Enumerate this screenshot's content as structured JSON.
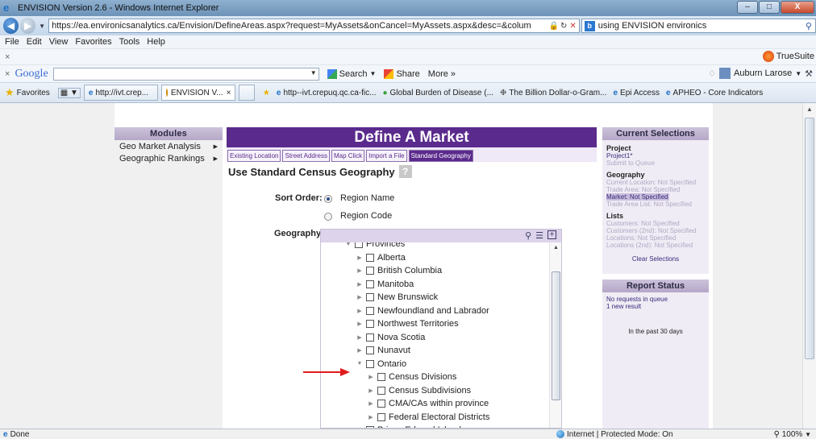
{
  "window": {
    "title": "ENVISION Version 2.6 - Windows Internet Explorer",
    "buttons": {
      "minimize": "–",
      "maximize": "□",
      "close": "X"
    }
  },
  "address_bar": {
    "url": "https://ea.environicsanalytics.ca/Envision/DefineAreas.aspx?request=MyAssets&onCancel=MyAssets.aspx&desc=&column=0&forceStd=0&pageloc=",
    "search_text": "using ENVISION environics"
  },
  "menu": [
    "File",
    "Edit",
    "View",
    "Favorites",
    "Tools",
    "Help"
  ],
  "toolbar1": {
    "close": "×",
    "truesuite": "TrueSuite"
  },
  "google_bar": {
    "close": "×",
    "logo": "Google",
    "search": "Search",
    "share": "Share",
    "more": "More »",
    "user": "Auburn Larose"
  },
  "favorites_bar": {
    "favorites": "Favorites",
    "tabs": [
      "http://ivt.crep...",
      "ENVISION V..."
    ],
    "tab_close": "×",
    "links": [
      "http--ivt.crepuq.qc.ca-fic...",
      "Global Burden of Disease (...",
      "The Billion Dollar-o-Gram...",
      "Epi Access",
      "APHEO - Core Indicators"
    ]
  },
  "modules": {
    "header": "Modules",
    "items": [
      "Geo Market Analysis",
      "Geographic Rankings"
    ]
  },
  "main": {
    "title": "Define A Market",
    "tabs": [
      "Existing Location",
      "Street Address",
      "Map Click",
      "Import a File",
      "Standard Geography"
    ],
    "active_tab": 4,
    "section_title": "Use Standard Census Geography",
    "help": "?",
    "sort_order_label": "Sort Order:",
    "sort_options": [
      "Region Name",
      "Region Code"
    ],
    "sort_selected": 0,
    "geography_label": "Geography:",
    "geo_tools": {
      "search": "search-icon",
      "list": "list-icon",
      "expand": "+"
    },
    "tree": [
      {
        "label": "Provinces",
        "level": 0,
        "state": "expanded"
      },
      {
        "label": "Alberta",
        "level": 1,
        "state": "collapsed"
      },
      {
        "label": "British Columbia",
        "level": 1,
        "state": "collapsed"
      },
      {
        "label": "Manitoba",
        "level": 1,
        "state": "collapsed"
      },
      {
        "label": "New Brunswick",
        "level": 1,
        "state": "collapsed"
      },
      {
        "label": "Newfoundland and Labrador",
        "level": 1,
        "state": "collapsed"
      },
      {
        "label": "Northwest Territories",
        "level": 1,
        "state": "collapsed"
      },
      {
        "label": "Nova Scotia",
        "level": 1,
        "state": "collapsed"
      },
      {
        "label": "Nunavut",
        "level": 1,
        "state": "collapsed"
      },
      {
        "label": "Ontario",
        "level": 1,
        "state": "expanded"
      },
      {
        "label": "Census Divisions",
        "level": 2,
        "state": "collapsed"
      },
      {
        "label": "Census Subdivisions",
        "level": 2,
        "state": "collapsed"
      },
      {
        "label": "CMA/CAs within province",
        "level": 2,
        "state": "collapsed"
      },
      {
        "label": "Federal Electoral Districts",
        "level": 2,
        "state": "collapsed"
      },
      {
        "label": "Prince Edward Island",
        "level": 1,
        "state": "collapsed"
      }
    ]
  },
  "current_selections": {
    "header": "Current Selections",
    "project_h": "Project",
    "project": "Project1*",
    "submit": "Submit to Queue",
    "geography_h": "Geography",
    "current_location": "Current Location:  Not Specified",
    "trade_area": "Trade Area:  Not Specified",
    "market": "Market: Not Specified",
    "trade_area_list": "Trade Area List:  Not Specified",
    "lists_h": "Lists",
    "customers": "Customers:  Not Specified",
    "customers2": "Customers (2nd):  Not Specified",
    "locations": "Locations:  Not Specified",
    "locations2": "Locations (2nd):  Not Specified",
    "clear": "Clear Selections"
  },
  "report_status": {
    "header": "Report Status",
    "line1": "No requests in queue",
    "line2": "1 new result",
    "past": "In the past 30 days"
  },
  "status_bar": {
    "done": "Done",
    "zone": "Internet | Protected Mode: On",
    "zoom": "100%"
  }
}
